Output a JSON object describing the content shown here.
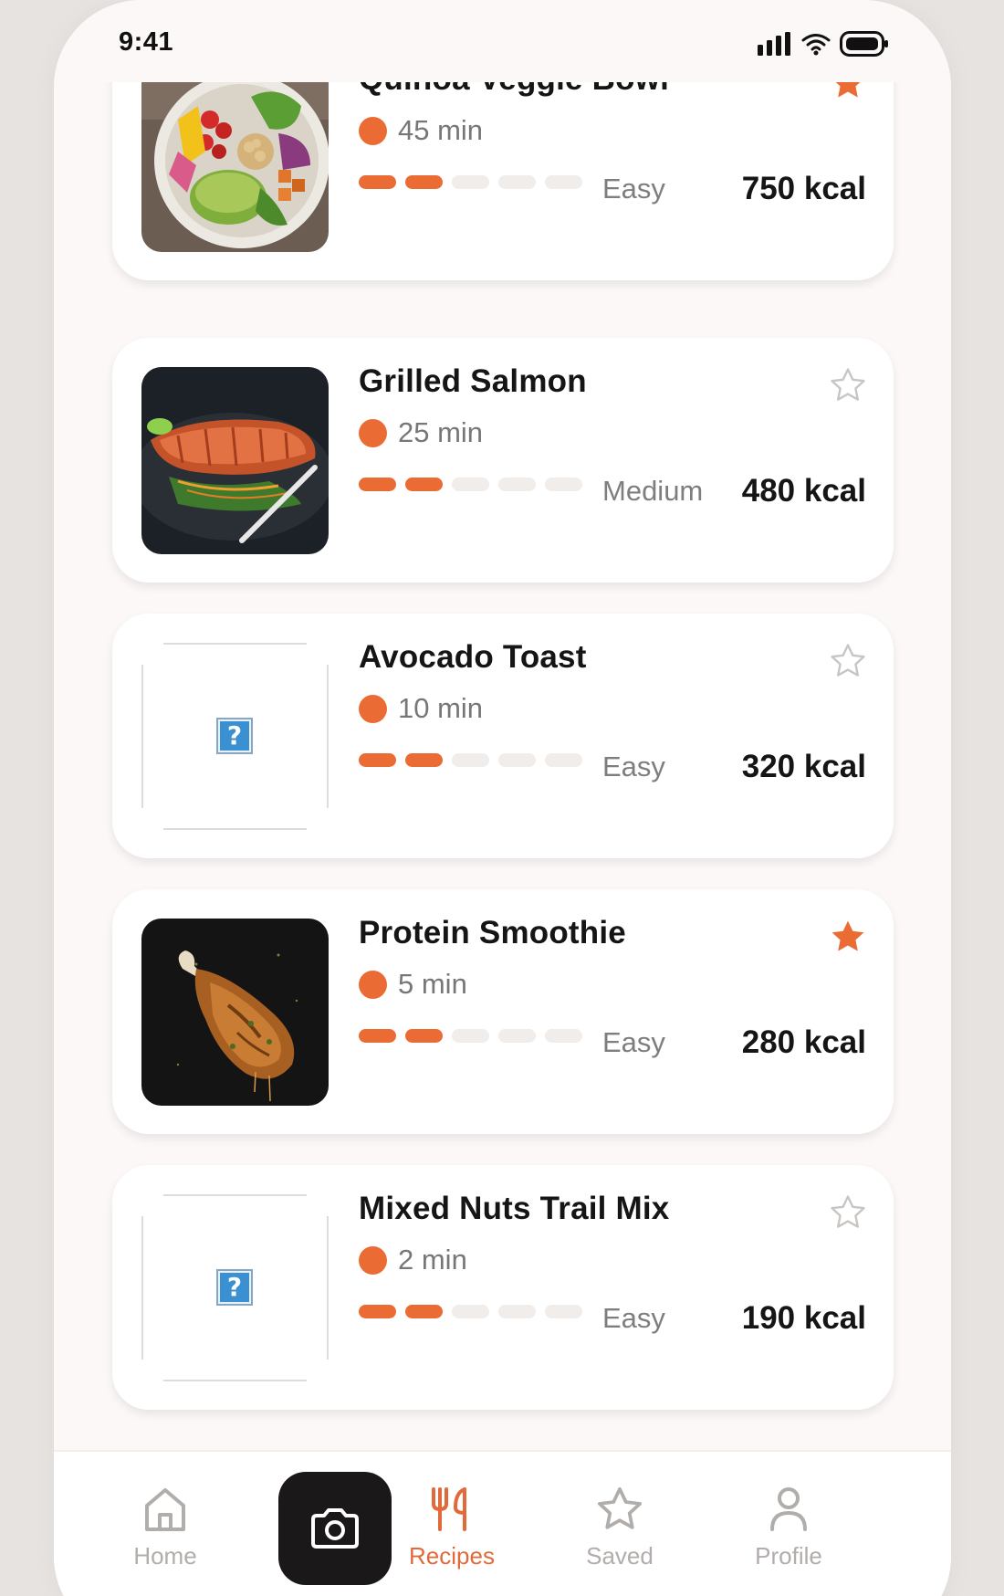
{
  "status_bar": {
    "time": "9:41"
  },
  "recipes": [
    {
      "title": "Quinoa Veggie Bowl",
      "time": "45 min",
      "difficulty_level": 2,
      "difficulty_max": 5,
      "difficulty": "Easy",
      "kcal": "750 kcal",
      "favorite": true,
      "image": "quinoa-bowl-photo"
    },
    {
      "title": "Grilled Salmon",
      "time": "25 min",
      "difficulty_level": 2,
      "difficulty_max": 5,
      "difficulty": "Medium",
      "kcal": "480 kcal",
      "favorite": false,
      "image": "grilled-salmon-photo"
    },
    {
      "title": "Avocado Toast",
      "time": "10 min",
      "difficulty_level": 2,
      "difficulty_max": 5,
      "difficulty": "Easy",
      "kcal": "320 kcal",
      "favorite": false,
      "image": "broken-image"
    },
    {
      "title": "Protein Smoothie",
      "time": "5 min",
      "difficulty_level": 2,
      "difficulty_max": 5,
      "difficulty": "Easy",
      "kcal": "280 kcal",
      "favorite": true,
      "image": "chicken-leg-photo"
    },
    {
      "title": "Mixed Nuts Trail Mix",
      "time": "2 min",
      "difficulty_level": 2,
      "difficulty_max": 5,
      "difficulty": "Easy",
      "kcal": "190 kcal",
      "favorite": false,
      "image": "broken-image"
    }
  ],
  "nav": {
    "home": "Home",
    "recipes": "Recipes",
    "saved": "Saved",
    "profile": "Profile",
    "active": "recipes"
  },
  "colors": {
    "accent": "#ea6c34",
    "dark": "#1a1818",
    "muted": "#b0adab",
    "background": "#fbf8f7"
  }
}
